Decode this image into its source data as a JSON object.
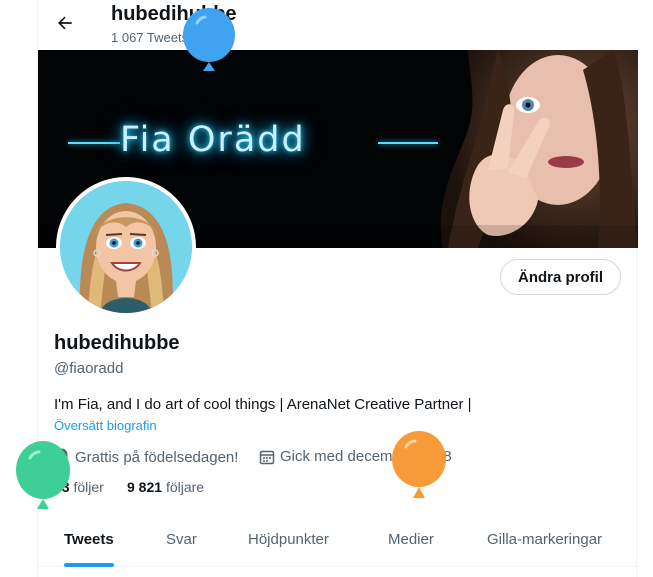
{
  "header": {
    "back_icon": "arrow-left-icon",
    "name": "hubedihubbe",
    "tweet_count": "1 067 Tweets"
  },
  "banner": {
    "title": "Fia Orädd"
  },
  "actions": {
    "edit_profile": "Ändra profil"
  },
  "profile": {
    "name": "hubedihubbe",
    "handle": "@fiaoradd",
    "bio": "I'm Fia, and I do art of cool things | ArenaNet Creative Partner |",
    "translate_bio": "Översätt biografin",
    "birthday": "Grattis på födelsedagen!",
    "birthday_icon": "balloon-icon",
    "joined": "Gick med december 2018",
    "joined_icon": "calendar-icon"
  },
  "stats": {
    "following_count": "73",
    "following_label": "följer",
    "followers_count": "9 821",
    "followers_label": "följare"
  },
  "tabs": [
    {
      "label": "Tweets",
      "active": true
    },
    {
      "label": "Svar",
      "active": false
    },
    {
      "label": "Höjdpunkter",
      "active": false
    },
    {
      "label": "Medier",
      "active": false
    },
    {
      "label": "Gilla-markeringar",
      "active": false
    }
  ],
  "colors": {
    "accent": "#1d9bf0",
    "text_primary": "#0f1419",
    "text_secondary": "#536471",
    "balloon_blue": "#3fa3f0",
    "balloon_green": "#3ecf97",
    "balloon_orange": "#f79b3a"
  }
}
